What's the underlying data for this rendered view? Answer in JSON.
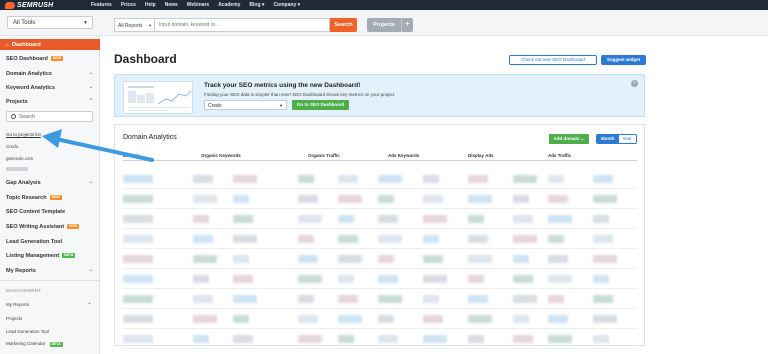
{
  "topnav": {
    "brand": "SEMRUSH",
    "links": [
      "Features",
      "Prices",
      "Help",
      "News",
      "Webinars",
      "Academy",
      "Blog ▾",
      "Company ▾"
    ]
  },
  "toolbar": {
    "tools_select": "All Tools",
    "reports_select": "All Reports",
    "search_placeholder": "Input domain, keyword or...",
    "search_label": "Search",
    "projects_label": "Projects",
    "projects_plus": "+"
  },
  "sidebar": {
    "dashboard": "Dashboard",
    "seo_dashboard": "SEO Dashboard",
    "domain_analytics": "Domain Analytics",
    "keyword_analytics": "Keyword Analytics",
    "projects": "Projects",
    "search_placeholder": "Search",
    "go_to_projects": "Go to projects list",
    "credo": "Credo",
    "getcredo": "getcredo.com",
    "gap_analysis": "Gap Analysis",
    "topic_research": "Topic Research",
    "seo_content_template": "SEO Content Template",
    "seo_writing_assistant": "SEO Writing Assistant",
    "lead_generation_tool": "Lead Generation Tool",
    "listing_management": "Listing Management",
    "my_reports": "My Reports",
    "management_heading": "MANAGEMENT",
    "mgmt_my_reports": "My Reports",
    "mgmt_projects": "Projects",
    "mgmt_lead_generation": "Lead Generation Tool",
    "mgmt_marketing_calendar": "Marketing Calendar",
    "badge_new": "NEW",
    "badge_beta": "BETA"
  },
  "main": {
    "title": "Dashboard",
    "check_new_btn": "Check out new SEO Dashboard",
    "suggest_btn": "Suggest widget"
  },
  "banner": {
    "title": "Track your SEO metrics using the new Dashboard!",
    "text": "Finding your SEO data is simpler than ever! SEO Dashboard shows key metrics on your project.",
    "select_value": "Credo",
    "go_btn": "Go to SEO Dashboard",
    "close": "×"
  },
  "domain_analytics": {
    "title": "Domain Analytics",
    "add_btn": "Add domain ...",
    "period_month": "Month",
    "period_year": "Year",
    "columns": [
      "Domain",
      "Organic Keywords",
      "Organic Traffic",
      "Ads Keywords",
      "Display Ads",
      "Ads Traffic"
    ]
  },
  "colors": {
    "accent_orange": "#ee6328",
    "brand_blue": "#2d7ad5",
    "green": "#4eae4a",
    "topbar": "#1f2a36"
  }
}
